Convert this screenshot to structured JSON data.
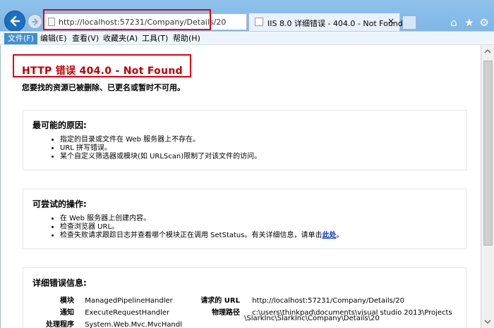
{
  "browser": {
    "address": "http://localhost:57231/Company/Details/20",
    "tab_title": "IIS 8.0 详细错误 - 404.0 - Not Found",
    "tab_close": "×",
    "menu": [
      "文件(F)",
      "编辑(E)",
      "查看(V)",
      "收藏夹(A)",
      "工具(T)",
      "帮助(H)"
    ],
    "icons": {
      "back": "back-arrow-icon",
      "forward": "forward-arrow-icon",
      "search": "search-icon",
      "refresh": "refresh-icon",
      "home": "home-icon",
      "favorites": "star-icon",
      "settings": "gear-icon"
    }
  },
  "page": {
    "error_title": "HTTP 错误 404.0 - Not Found",
    "error_subtitle": "您要找的资源已被删除、已更名或暂时不可用。",
    "causes": {
      "title": "最可能的原因:",
      "items": [
        "指定的目录或文件在 Web 服务器上不存在。",
        "URL 拼写错误。",
        "某个自定义筛选器或模块(如 URLScan)限制了对该文件的访问。"
      ]
    },
    "actions": {
      "title": "可尝试的操作:",
      "items": [
        "在 Web 服务器上创建内容。",
        "检查浏览器 URL。",
        "检查失败请求跟踪日志并查看哪个模块正在调用 SetStatus。有关详细信息，请单击"
      ],
      "link": "此处",
      "link_suffix": "。"
    },
    "details": {
      "title": "详细错误信息:",
      "rows": [
        {
          "label": "模块",
          "value": "ManagedPipelineHandler"
        },
        {
          "label": "通知",
          "value": "ExecuteRequestHandler"
        },
        {
          "label": "处理程序",
          "value": "System.Web.Mvc.MvcHandl"
        }
      ],
      "right_rows": [
        {
          "label": "请求的 URL",
          "value": "http://localhost:57231/Company/Details/20"
        },
        {
          "label": "物理路径",
          "value": "c:\\users\\thinkpad\\documents\\visual studio 2013\\Projects",
          "value2": "\\SlarkInc\\SlarkInc\\Company\\Details\\20"
        }
      ]
    }
  }
}
